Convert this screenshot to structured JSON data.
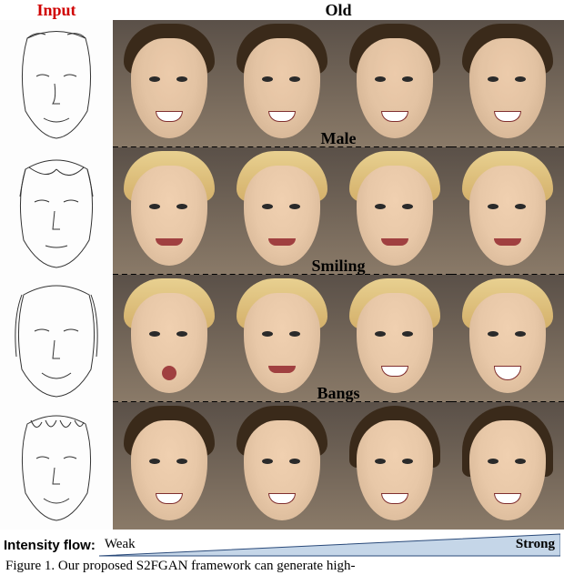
{
  "labels": {
    "input": "Input",
    "intensity_flow": "Intensity flow:",
    "weak": "Weak",
    "strong": "Strong"
  },
  "rows": [
    {
      "attribute": "Old",
      "hair": "dark",
      "mouth": "smile",
      "variant": "old"
    },
    {
      "attribute": "Male",
      "hair": "blonde",
      "mouth": "normal",
      "variant": "male"
    },
    {
      "attribute": "Smiling",
      "hair": "blonde",
      "mouth": "smile",
      "variant": "smile"
    },
    {
      "attribute": "Bangs",
      "hair": "dark",
      "mouth": "smile",
      "variant": "bangs"
    }
  ],
  "columns_per_row": 4,
  "caption": "Figure 1. Our proposed S2FGAN framework can generate high-"
}
